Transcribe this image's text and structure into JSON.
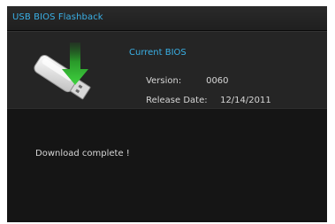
{
  "window": {
    "title": "USB BIOS Flashback"
  },
  "bios_info": {
    "heading": "Current BIOS",
    "version_label": "Version:",
    "version_value": "0060",
    "release_date_label": "Release Date:",
    "release_date_value": "12/14/2011",
    "icon": "usb-drive-download-icon"
  },
  "status": {
    "message": "Download complete !"
  },
  "colors": {
    "accent": "#3ab0e6",
    "text": "#d6d6d6",
    "background": "#151515",
    "panel": "#252525",
    "arrow": "#2fb82f"
  }
}
